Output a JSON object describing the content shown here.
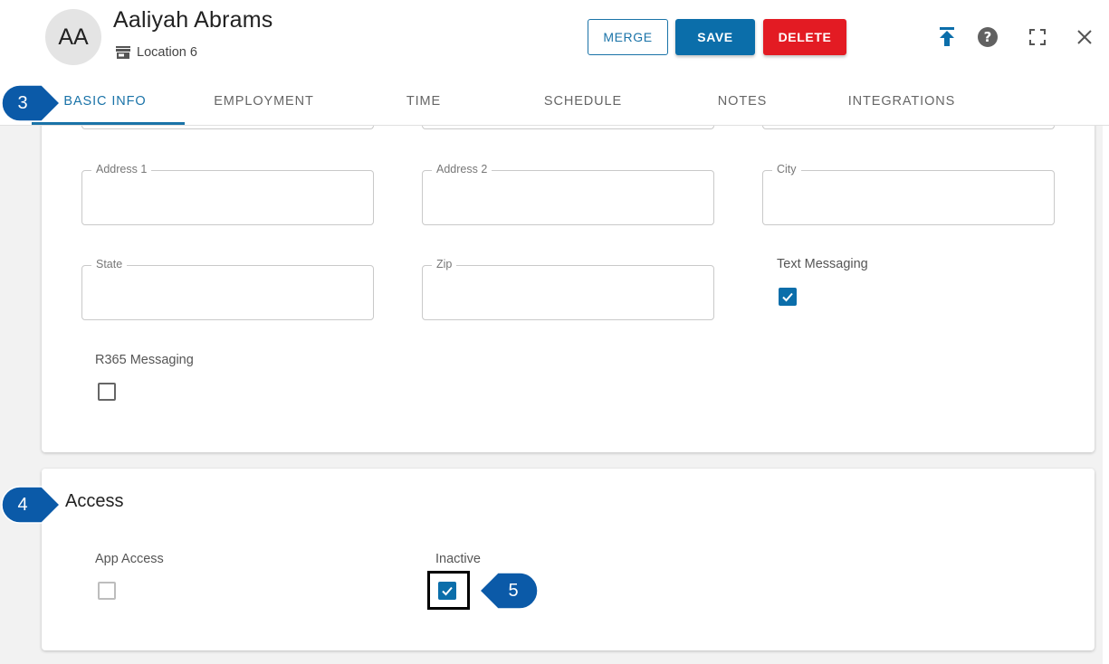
{
  "header": {
    "avatar_initials": "AA",
    "name": "Aaliyah Abrams",
    "location": "Location 6",
    "buttons": {
      "merge": "MERGE",
      "save": "SAVE",
      "delete": "DELETE"
    },
    "icons": [
      "upload-icon",
      "help-icon",
      "fullscreen-icon",
      "close-icon"
    ]
  },
  "tabs": [
    {
      "label": "BASIC INFO",
      "active": true
    },
    {
      "label": "EMPLOYMENT",
      "active": false
    },
    {
      "label": "TIME",
      "active": false
    },
    {
      "label": "SCHEDULE",
      "active": false
    },
    {
      "label": "NOTES",
      "active": false
    },
    {
      "label": "INTEGRATIONS",
      "active": false
    }
  ],
  "basic_info": {
    "fields": {
      "address1": {
        "label": "Address 1",
        "value": ""
      },
      "address2": {
        "label": "Address 2",
        "value": ""
      },
      "city": {
        "label": "City",
        "value": ""
      },
      "state": {
        "label": "State",
        "value": ""
      },
      "zip": {
        "label": "Zip",
        "value": ""
      }
    },
    "text_messaging": {
      "label": "Text Messaging",
      "checked": true
    },
    "r365_messaging": {
      "label": "R365 Messaging",
      "checked": false
    }
  },
  "access": {
    "title": "Access",
    "app_access": {
      "label": "App Access",
      "checked": false,
      "disabled": true
    },
    "inactive": {
      "label": "Inactive",
      "checked": true
    }
  },
  "callouts": {
    "tabs_step": "3",
    "access_step": "4",
    "inactive_step": "5"
  },
  "colors": {
    "primary": "#0b6eaa",
    "danger": "#e31b23",
    "marker": "#0b5aa8"
  }
}
